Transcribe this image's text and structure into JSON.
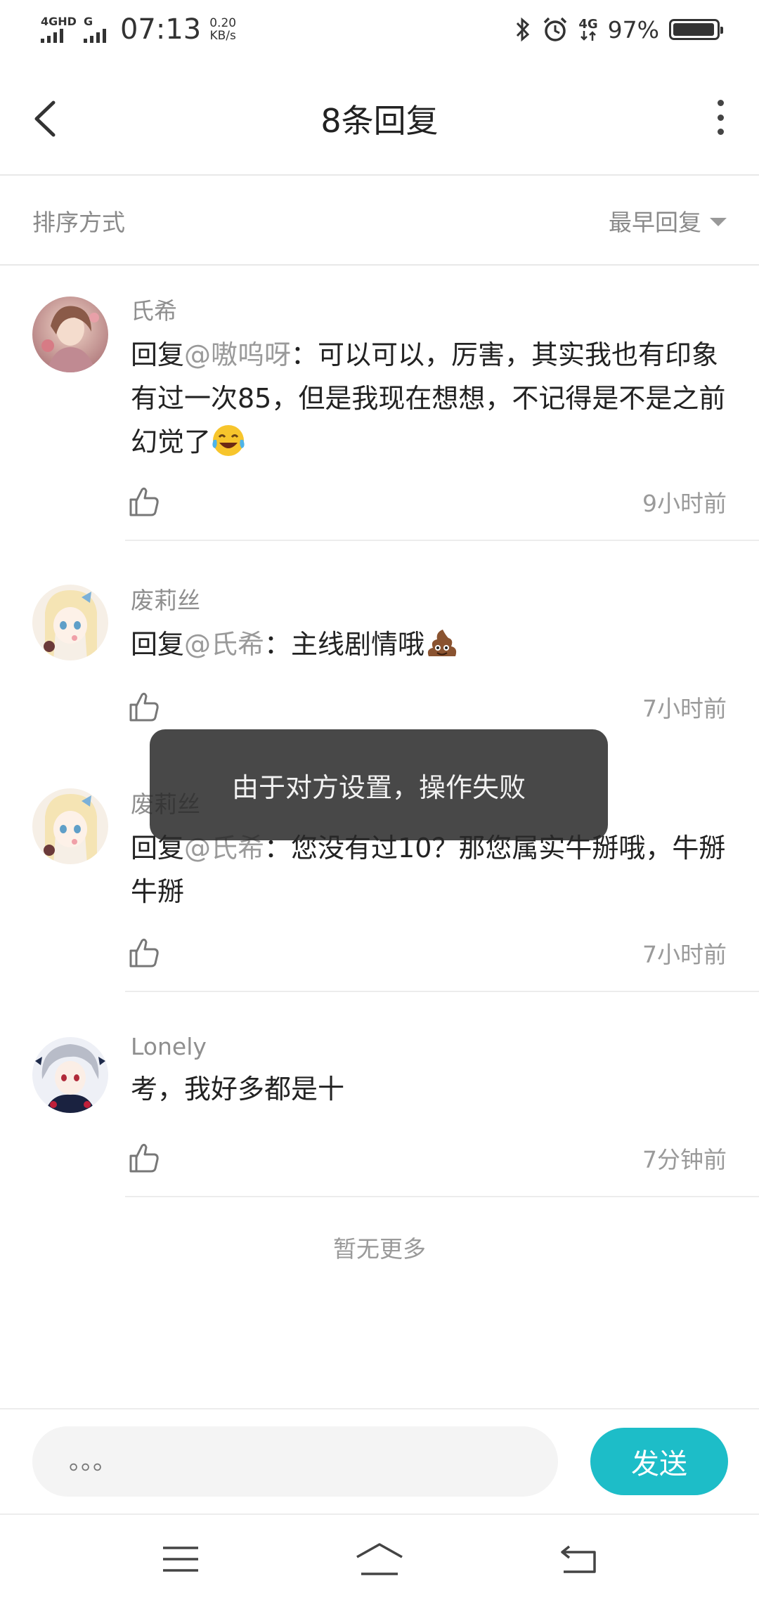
{
  "status_bar": {
    "signal_1_label": "4GHD",
    "signal_2_label": "G",
    "time": "07:13",
    "speed_value": "0.20",
    "speed_unit": "KB/s",
    "network_right": "4G",
    "battery_percent": "97%",
    "battery_level": 0.97
  },
  "header": {
    "title": "8条回复",
    "back_icon": "chevron-left-icon",
    "more_icon": "more-vertical-icon"
  },
  "sort": {
    "label": "排序方式",
    "selected": "最早回复"
  },
  "comments": [
    {
      "user": "氏希",
      "reply_prefix": "回复",
      "mention": "@嗷呜呀",
      "text": "：可以可以，厉害，其实我也有印象有过一次85，但是我现在想想，不记得是不是之前幻觉了",
      "emoji": "laughing-tears-emoji",
      "time": "9小时前"
    },
    {
      "user": "废莉丝",
      "reply_prefix": "回复",
      "mention": "@氏希",
      "text": "：主线剧情哦",
      "emoji": "poop-emoji",
      "time": "7小时前"
    },
    {
      "user": "废莉丝",
      "reply_prefix": "回复",
      "mention": "@氏希",
      "text": "：您没有过10？那您属实牛掰哦，牛掰牛掰",
      "time": "7小时前"
    },
    {
      "user": "Lonely",
      "text": "考，我好多都是十",
      "time": "7分钟前"
    }
  ],
  "no_more_text": "暂无更多",
  "toast": "由于对方设置，操作失败",
  "input": {
    "placeholder": "。。。",
    "send_label": "发送"
  },
  "colors": {
    "accent": "#1dbdc8",
    "toast_bg": "#3a3a3a"
  },
  "nav_icons": [
    "menu-icon",
    "home-icon",
    "back-return-icon"
  ]
}
